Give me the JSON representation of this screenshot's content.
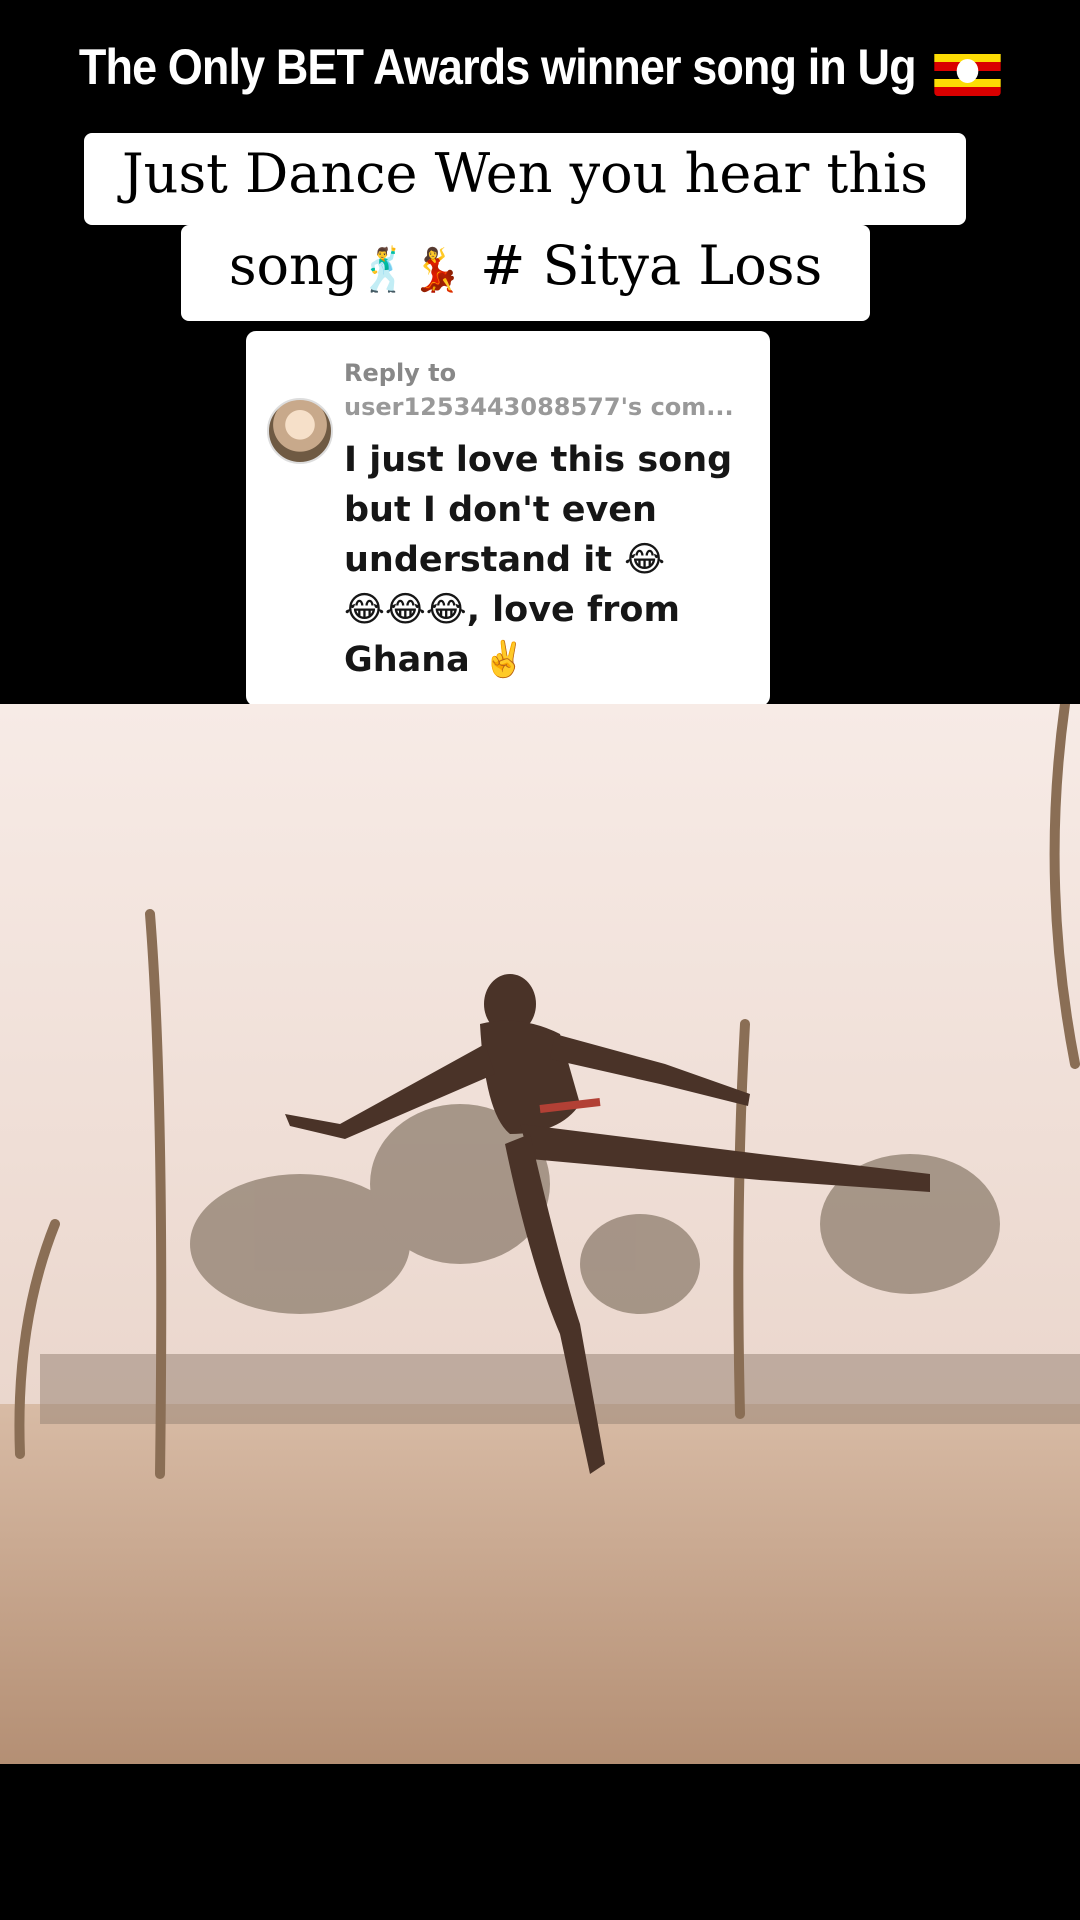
{
  "overlay": {
    "title": "The Only BET Awards winner song in Ug",
    "title_flag_icon": "uganda-flag-icon",
    "caption_line1": "Just Dance Wen you hear this",
    "caption_line2_prefix": "song",
    "caption_emoji1": "🕺",
    "caption_emoji2": "💃",
    "caption_line2_suffix": " # Sitya Loss"
  },
  "reply": {
    "label": "Reply to",
    "user": "user1253443088577's com...",
    "comment_lines": [
      "I just love this song",
      "but I don't even",
      "understand it 😂",
      "😂😂😂, love from",
      "Ghana ✌️"
    ]
  },
  "colors": {
    "flag_black": "#000000",
    "flag_yellow": "#FCDC04",
    "flag_red": "#D90000",
    "sky": "#f4e2dc",
    "ground": "#c9a487"
  }
}
